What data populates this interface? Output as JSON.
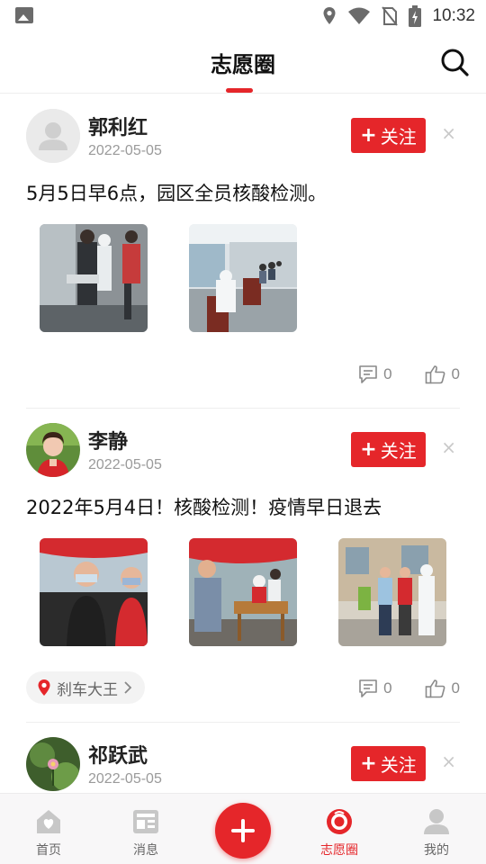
{
  "status_bar": {
    "time": "10:32",
    "icons": [
      "image-icon",
      "location-icon",
      "wifi-icon",
      "no-sim-icon",
      "battery-charging-icon"
    ]
  },
  "header": {
    "title": "志愿圈",
    "search_icon": "search-icon"
  },
  "posts": [
    {
      "username": "郭利红",
      "date": "2022-05-05",
      "follow_label": "关注",
      "follow_prefix": "+",
      "close_glyph": "×",
      "text": "5月5日早6点，园区全员核酸检测。",
      "photos": [
        "nucleic-test-photo-1",
        "nucleic-test-photo-2"
      ],
      "comments": "0",
      "likes": "0"
    },
    {
      "username": "李静",
      "date": "2022-05-05",
      "follow_label": "关注",
      "follow_prefix": "+",
      "close_glyph": "×",
      "text": "2022年5月4日！核酸检测！疫情早日退去",
      "photos": [
        "volunteers-photo-1",
        "volunteers-photo-2",
        "volunteers-photo-3"
      ],
      "location": "刹车大王",
      "comments": "0",
      "likes": "0"
    },
    {
      "username": "祁跃武",
      "date": "2022-05-05",
      "follow_label": "关注",
      "follow_prefix": "+",
      "close_glyph": "×"
    }
  ],
  "bottom_nav": {
    "items": [
      {
        "label": "首页",
        "icon": "home-icon"
      },
      {
        "label": "消息",
        "icon": "news-icon"
      },
      {
        "label": "志愿圈",
        "icon": "circle-icon",
        "active": true
      },
      {
        "label": "我的",
        "icon": "profile-icon"
      }
    ],
    "fab_icon": "plus-icon"
  },
  "colors": {
    "accent": "#e5262a",
    "muted_text": "#9a9a9a",
    "nav_bg": "#f8f7f8"
  }
}
